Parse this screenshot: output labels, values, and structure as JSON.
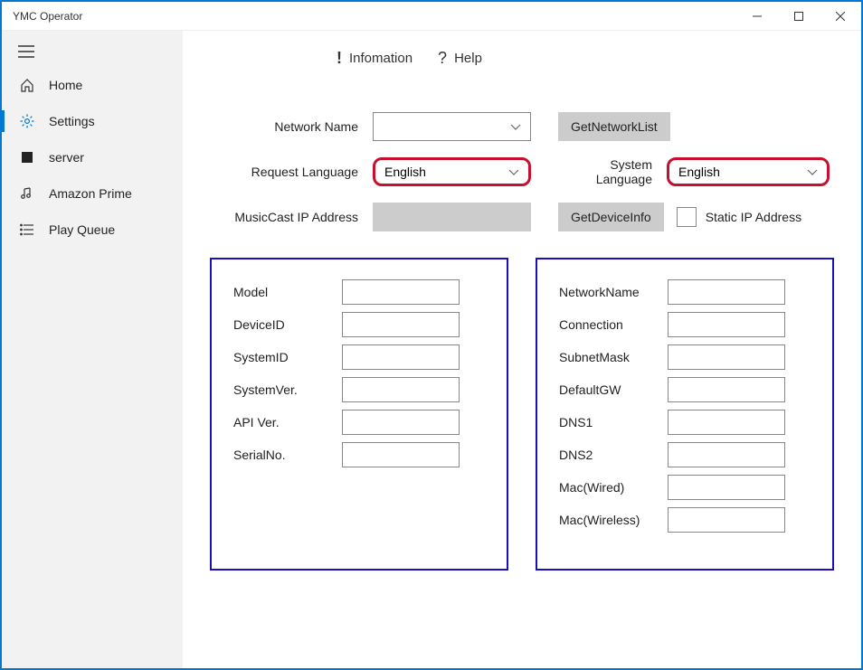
{
  "window": {
    "title": "YMC Operator"
  },
  "sidebar": {
    "items": [
      {
        "label": "Home"
      },
      {
        "label": "Settings"
      },
      {
        "label": "server"
      },
      {
        "label": "Amazon Prime"
      },
      {
        "label": "Play Queue"
      }
    ]
  },
  "tabs": {
    "information": "Infomation",
    "help": "Help"
  },
  "form": {
    "networkName_label": "Network Name",
    "networkName_value": "",
    "getNetworkList_label": "GetNetworkList",
    "requestLanguage_label": "Request Language",
    "requestLanguage_value": "English",
    "systemLanguage_label": "System Language",
    "systemLanguage_value": "English",
    "musicCastIp_label": "MusicCast IP Address",
    "musicCastIp_value": "",
    "getDeviceInfo_label": "GetDeviceInfo",
    "staticIp_label": "Static IP Address",
    "staticIp_checked": false
  },
  "leftPanel": {
    "fields": [
      {
        "label": "Model",
        "value": ""
      },
      {
        "label": "DeviceID",
        "value": ""
      },
      {
        "label": "SystemID",
        "value": ""
      },
      {
        "label": "SystemVer.",
        "value": ""
      },
      {
        "label": "API Ver.",
        "value": ""
      },
      {
        "label": "SerialNo.",
        "value": ""
      }
    ]
  },
  "rightPanel": {
    "fields": [
      {
        "label": "NetworkName",
        "value": ""
      },
      {
        "label": "Connection",
        "value": ""
      },
      {
        "label": "SubnetMask",
        "value": ""
      },
      {
        "label": "DefaultGW",
        "value": ""
      },
      {
        "label": "DNS1",
        "value": ""
      },
      {
        "label": "DNS2",
        "value": ""
      },
      {
        "label": "Mac(Wired)",
        "value": ""
      },
      {
        "label": "Mac(Wireless)",
        "value": ""
      }
    ]
  }
}
